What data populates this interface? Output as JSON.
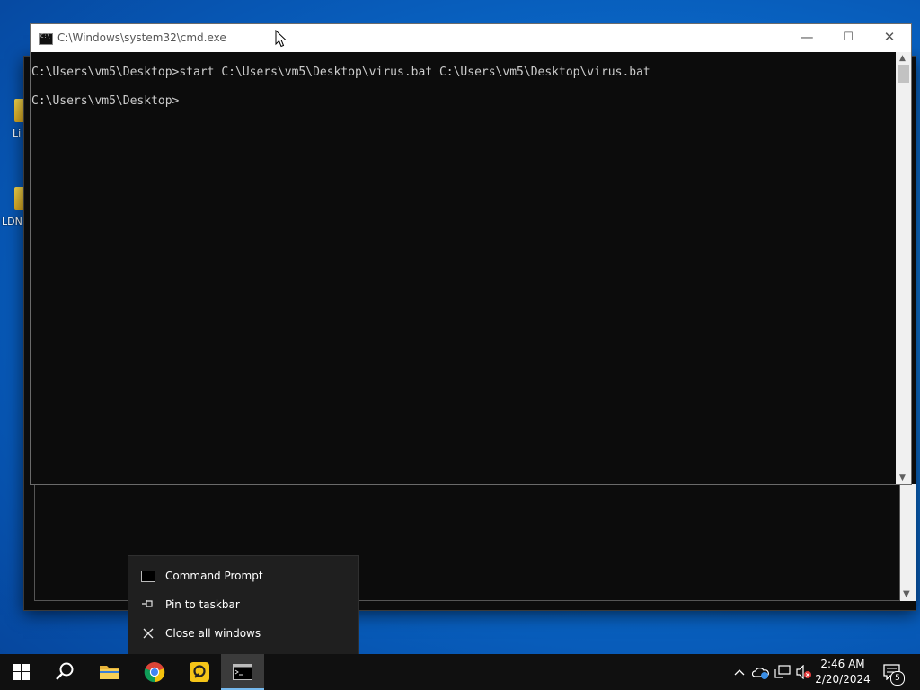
{
  "desktop": {
    "icons": [
      {
        "label": "Li"
      },
      {
        "label": "LDN"
      }
    ]
  },
  "window": {
    "title": "C:\\Windows\\system32\\cmd.exe",
    "minimize_glyph": "—",
    "maximize_glyph": "☐",
    "close_glyph": "✕"
  },
  "console": {
    "lines": [
      "C:\\Users\\vm5\\Desktop>start C:\\Users\\vm5\\Desktop\\virus.bat C:\\Users\\vm5\\Desktop\\virus.bat",
      "C:\\Users\\vm5\\Desktop>"
    ]
  },
  "jumplist": {
    "items": [
      {
        "label": "Command Prompt",
        "icon": "cmd-icon"
      },
      {
        "label": "Pin to taskbar",
        "icon": "pin-icon"
      },
      {
        "label": "Close all windows",
        "icon": "close-icon"
      }
    ]
  },
  "taskbar": {
    "buttons": [
      {
        "name": "start",
        "icon": "windows-logo-icon"
      },
      {
        "name": "search",
        "icon": "search-icon"
      },
      {
        "name": "file-explorer",
        "icon": "folder-icon"
      },
      {
        "name": "chrome",
        "icon": "chrome-icon"
      },
      {
        "name": "ldplayer",
        "icon": "ldplayer-icon"
      },
      {
        "name": "cmd",
        "icon": "cmd-icon",
        "active": true
      }
    ],
    "time": "2:46 AM",
    "date": "2/20/2024",
    "notification_count": "5"
  },
  "colors": {
    "console_bg": "#0c0c0c",
    "console_text": "#cccccc",
    "taskbar_bg": "#101010",
    "active_accent": "#76b9ed"
  }
}
